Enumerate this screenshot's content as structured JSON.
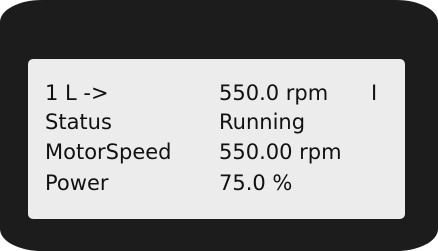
{
  "display": {
    "header": {
      "label": "1 L ->",
      "value": "550.0 rpm",
      "indicator": "I"
    },
    "rows": [
      {
        "label": "Status",
        "value": "Running"
      },
      {
        "label": "MotorSpeed",
        "value": "550.00 rpm"
      },
      {
        "label": "Power",
        "value": "75.0 %"
      }
    ]
  }
}
